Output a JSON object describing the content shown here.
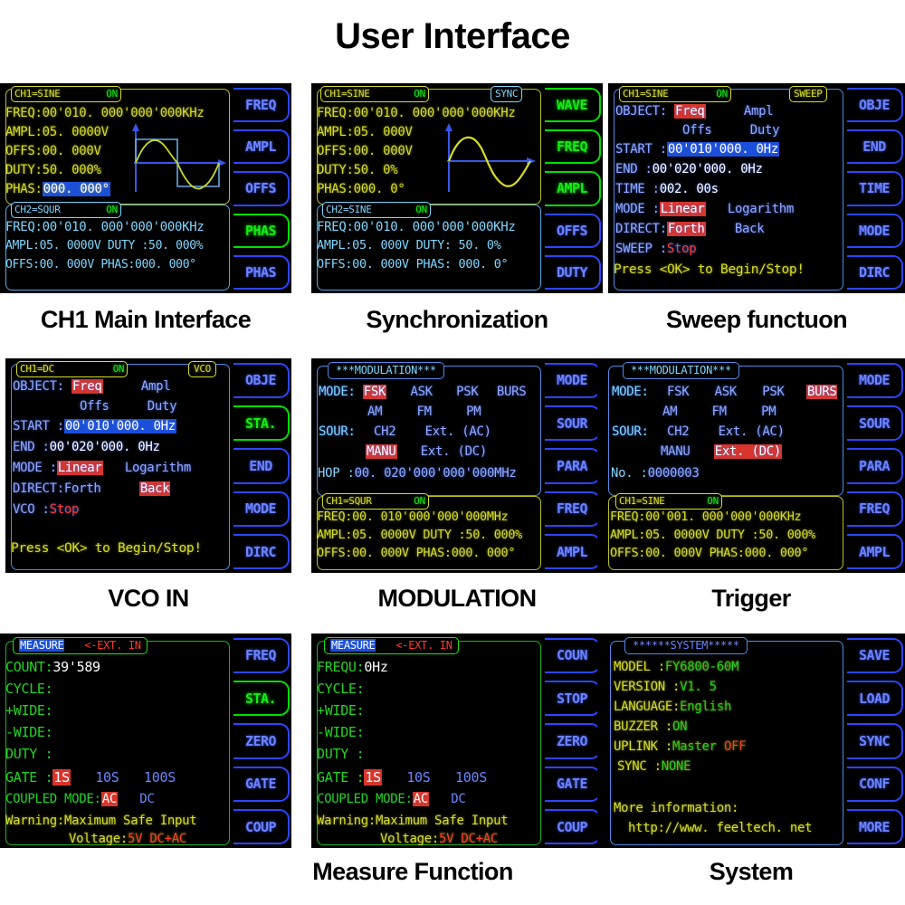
{
  "title": "User Interface",
  "colors": {
    "yellow": "#d8de28",
    "cyan": "#7fd7ff",
    "blue": "#93a9ff",
    "green": "#16e516",
    "red": "#ff3b30",
    "highlight_red": "#e03a30",
    "highlight_blue": "#1b4fd8",
    "background": "#000000"
  },
  "panels": [
    {
      "caption": "CH1 Main Interface",
      "ch1": {
        "header": "CH1=SINE",
        "state": "ON",
        "freq": "FREQ:00'010. 000'000'000KHz",
        "ampl": "AMPL:05. 0000V",
        "offs": "OFFS:00. 000V",
        "duty": "DUTY:50. 000%",
        "phas_label": "PHAS:",
        "phas_value": "000. 000°"
      },
      "ch2": {
        "header": "CH2=SQUR",
        "state": "ON",
        "freq": "FREQ:00'010. 000'000'000KHz",
        "ampl_duty": "AMPL:05. 0000V DUTY :50. 000%",
        "offs_phas": "OFFS:00. 000V  PHAS:000. 000°"
      },
      "buttons": [
        "FREQ",
        "AMPL",
        "OFFS",
        "PHAS",
        "PHAS"
      ],
      "active_button": 3
    },
    {
      "caption": "Synchronization",
      "ch1": {
        "header": "CH1=SINE",
        "state": "ON",
        "badge": "SYNC",
        "freq": "FREQ:00'010. 000'000'000KHz",
        "ampl": "AMPL:05. 000V",
        "offs": "OFFS:00. 000V",
        "duty": "DUTY:50. 0%",
        "phas": "PHAS:000. 0°"
      },
      "ch2": {
        "header": "CH2=SINE",
        "state": "ON",
        "freq": "FREQ:00'010. 000'000'000KHz",
        "ampl_duty": "AMPL:05. 000V  DUTY: 50. 0%",
        "offs_phas": "OFFS:00. 000V  PHAS: 000. 0°"
      },
      "buttons": [
        "WAVE",
        "FREQ",
        "AMPL",
        "OFFS",
        "DUTY"
      ],
      "active_buttons": [
        0,
        1,
        2
      ]
    },
    {
      "caption": "Sweep functuon",
      "header": "CH1=SINE",
      "state": "ON",
      "badge": "SWEEP",
      "object_label": "OBJECT:",
      "object_options": [
        "Freq",
        "Ampl",
        "Offs",
        "Duty"
      ],
      "object_selected": "Freq",
      "start_label": "START :",
      "start_value": "00'010'000. 0Hz",
      "end_label": "END   :",
      "end_value": "00'020'000. 0Hz",
      "time_label": "TIME  :",
      "time_value": "002. 00s",
      "mode_label": "MODE  :",
      "mode_options": [
        "Linear",
        "Logarithm"
      ],
      "mode_selected": "Linear",
      "direct_label": "DIRECT:",
      "direct_options": [
        "Forth",
        "Back"
      ],
      "direct_selected": "Forth",
      "sweep_label": "SWEEP :",
      "sweep_value": "Stop",
      "footer": "Press <OK> to Begin/Stop!",
      "buttons": [
        "OBJE",
        "END",
        "TIME",
        "MODE",
        "DIRC"
      ],
      "active_button": -1
    },
    {
      "caption": "VCO IN",
      "header": "CH1=DC",
      "state": "ON",
      "badge": "VCO",
      "object_label": "OBJECT:",
      "object_options": [
        "Freq",
        "Ampl",
        "Offs",
        "Duty"
      ],
      "object_selected": "Freq",
      "start_label": "START :",
      "start_value": "00'010'000. 0Hz",
      "end_label": "END   :",
      "end_value": "00'020'000. 0Hz",
      "mode_label": "MODE  :",
      "mode_options": [
        "Linear",
        "Logarithm"
      ],
      "mode_selected": "Linear",
      "direct_label": "DIRECT:",
      "direct_options": [
        "Forth",
        "Back"
      ],
      "direct_selected": "Back",
      "vco_label": "VCO   :",
      "vco_value": "Stop",
      "footer": "Press <OK> to Begin/Stop!",
      "buttons": [
        "OBJE",
        "STA.",
        "END",
        "MODE",
        "DIRC"
      ],
      "active_button": 1
    },
    {
      "caption": "MODULATION",
      "header": "***MODULATION***",
      "mode_label": "MODE:",
      "mode_options_row1": [
        "FSK",
        "ASK",
        "PSK",
        "BURS"
      ],
      "mode_options_row2": [
        "AM",
        "FM",
        "PM"
      ],
      "mode_selected": "FSK",
      "sour_label": "SOUR:",
      "sour_options_row1": [
        "CH2",
        "Ext. (AC)"
      ],
      "sour_options_row2": [
        "MANU",
        "Ext. (DC)"
      ],
      "sour_selected": "MANU",
      "hop_label": "HOP  :",
      "hop_value": "00. 020'000'000'000MHz",
      "ch1": {
        "header": "CH1=SQUR",
        "state": "ON",
        "freq": "FREQ:00. 010'000'000'000MHz",
        "ampl_duty": "AMPL:05. 0000V DUTY :50. 000%",
        "offs_phas": "OFFS:00. 000V  PHAS:000. 000°"
      },
      "buttons": [
        "MODE",
        "SOUR",
        "PARA",
        "FREQ",
        "AMPL"
      ],
      "active_button": -1
    },
    {
      "caption": "Trigger",
      "header": "***MODULATION***",
      "mode_label": "MODE:",
      "mode_options_row1": [
        "FSK",
        "ASK",
        "PSK",
        "BURS"
      ],
      "mode_options_row2": [
        "AM",
        "FM",
        "PM"
      ],
      "mode_selected": "BURS",
      "sour_label": "SOUR:",
      "sour_options_row1": [
        "CH2",
        "Ext. (AC)"
      ],
      "sour_options_row2": [
        "MANU",
        "Ext. (DC)"
      ],
      "sour_selected": "Ext. (DC)",
      "no_label": "No.  :",
      "no_value": "0000003",
      "ch1": {
        "header": "CH1=SINE",
        "state": "ON",
        "freq": "FREQ:00'001. 000'000'000KHz",
        "ampl_duty": "AMPL:05. 0000V DUTY :50. 000%",
        "offs_phas": "OFFS:00. 000V  PHAS:000. 000°"
      },
      "buttons": [
        "MODE",
        "SOUR",
        "PARA",
        "FREQ",
        "AMPL"
      ],
      "active_button": -1
    },
    {
      "caption": "Measure Function",
      "header_main": "MEASURE",
      "header_sub": "<-EXT. IN",
      "rows": [
        {
          "label": "COUNT:",
          "value": "39'589"
        },
        {
          "label": "CYCLE:",
          "value": ""
        },
        {
          "label": "+WIDE:",
          "value": ""
        },
        {
          "label": "-WIDE:",
          "value": ""
        },
        {
          "label": "DUTY :",
          "value": ""
        }
      ],
      "gate_label": "GATE :",
      "gate_options": [
        "1S",
        "10S",
        "100S"
      ],
      "gate_selected": "1S",
      "coupled_label": "COUPLED MODE:",
      "coupled_options": [
        "AC",
        "DC"
      ],
      "coupled_selected": "AC",
      "warning_line1": "Warning:Maximum Safe Input",
      "warning_line2_label": "Voltage:",
      "warning_line2_value": "5V DC+AC",
      "buttons": [
        "FREQ",
        "STA.",
        "ZERO",
        "GATE",
        "COUP"
      ],
      "active_button": 1
    },
    {
      "caption": "",
      "header_main": "MEASURE",
      "header_sub": "<-EXT. IN",
      "rows": [
        {
          "label": "FREQU:",
          "value": "0Hz"
        },
        {
          "label": "CYCLE:",
          "value": ""
        },
        {
          "label": "+WIDE:",
          "value": ""
        },
        {
          "label": "-WIDE:",
          "value": ""
        },
        {
          "label": "DUTY :",
          "value": ""
        }
      ],
      "gate_label": "GATE :",
      "gate_options": [
        "1S",
        "10S",
        "100S"
      ],
      "gate_selected": "1S",
      "coupled_label": "COUPLED MODE:",
      "coupled_options": [
        "AC",
        "DC"
      ],
      "coupled_selected": "AC",
      "warning_line1": "Warning:Maximum Safe Input",
      "warning_line2_label": "Voltage:",
      "warning_line2_value": "5V DC+AC",
      "buttons": [
        "COUN",
        "STOP",
        "ZERO",
        "GATE",
        "COUP"
      ],
      "active_button": -1
    },
    {
      "caption": "System",
      "header": "******SYSTEM*****",
      "rows": [
        {
          "label": "MODEL   :",
          "value": "FY6800-60M"
        },
        {
          "label": "VERSION :",
          "value": "V1. 5"
        },
        {
          "label": "LANGUAGE:",
          "value": "English"
        },
        {
          "label": "BUZZER  :",
          "value": "ON"
        },
        {
          "label": "UPLINK  :",
          "value": "Master ",
          "value2": "OFF"
        },
        {
          "label": "SYNC    :",
          "value": "NONE"
        }
      ],
      "more_info_label": "More information:",
      "more_info_url": "http://www. feeltech. net",
      "buttons": [
        "SAVE",
        "LOAD",
        "SYNC",
        "CONF",
        "MORE"
      ],
      "active_button": -1
    }
  ],
  "captions": [
    "CH1 Main Interface",
    "Synchronization",
    "Sweep functuon",
    "VCO IN",
    "MODULATION",
    "Trigger",
    "Measure Function",
    "System"
  ]
}
